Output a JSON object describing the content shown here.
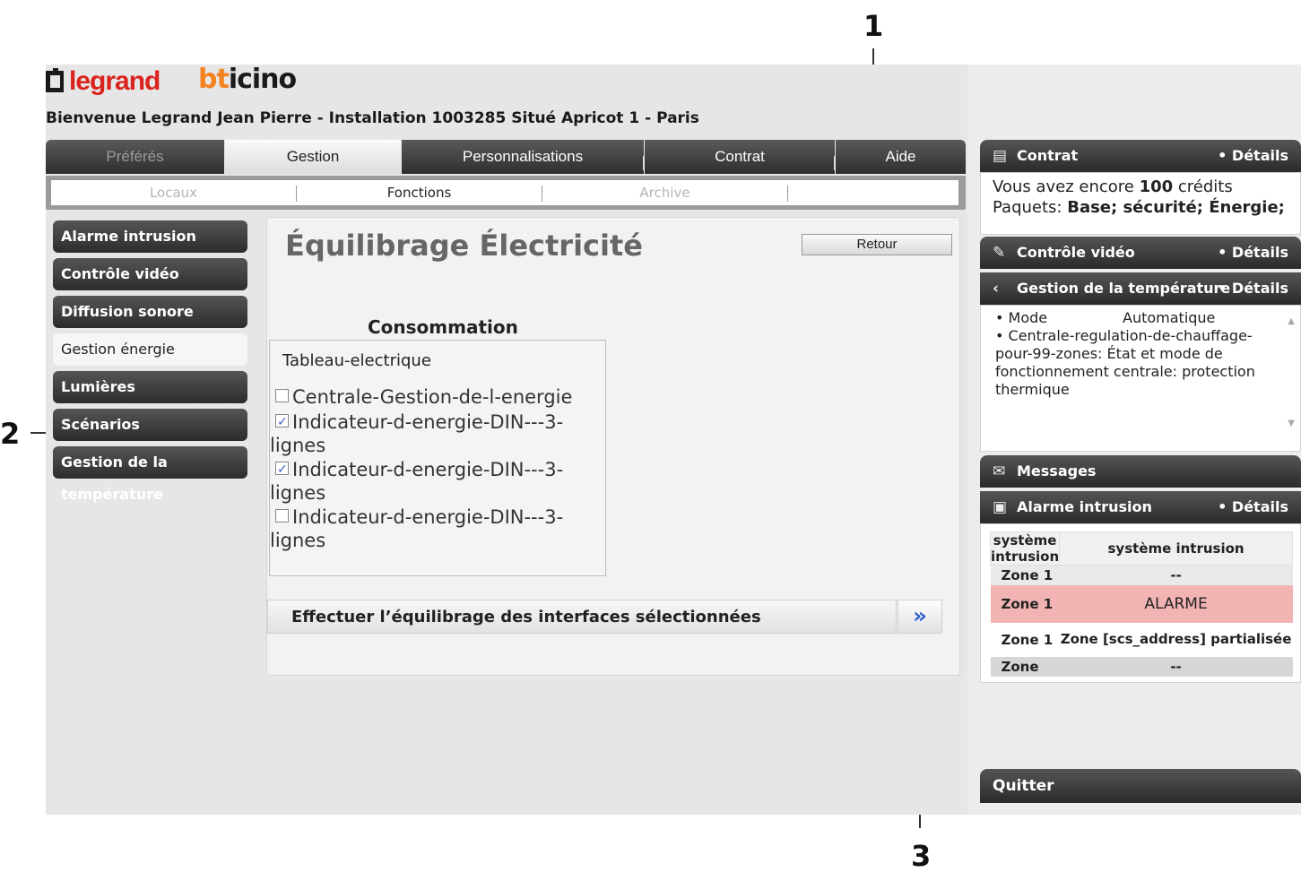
{
  "callouts": [
    "1",
    "2",
    "3"
  ],
  "brand": {
    "legrand": "legrand",
    "bticino_b": "bt",
    "bticino_rest": "icino"
  },
  "welcome": "Bienvenue Legrand Jean Pierre - Installation 1003285 Situé Apricot 1 - Paris",
  "topnav": [
    "Préférés",
    "Gestion",
    "Personnalisations",
    "Contrat",
    "Aide"
  ],
  "subnav": [
    "Locaux",
    "Fonctions",
    "Archive"
  ],
  "menu": [
    "Alarme intrusion",
    "Contrôle vidéo",
    "Diffusion sonore",
    "Gestion énergie",
    "Lumières",
    "Scénarios",
    "Gestion de la température"
  ],
  "content": {
    "title": "Équilibrage Électricité",
    "retour": "Retour",
    "conso_title": "Consommation",
    "tableau": "Tableau-electrique",
    "items": [
      {
        "line1": "Centrale-Gestion-de-l-energie",
        "line2": "",
        "checked": false
      },
      {
        "line1": "Indicateur-d-energie-DIN---3-",
        "line2": "lignes",
        "checked": true
      },
      {
        "line1": "Indicateur-d-energie-DIN---3-",
        "line2": "lignes",
        "checked": true
      },
      {
        "line1": "Indicateur-d-energie-DIN---3-",
        "line2": "lignes",
        "checked": false
      }
    ],
    "action_label": "Effectuer l’équilibrage des interfaces sélectionnées",
    "action_btn": "»"
  },
  "right": {
    "contrat": {
      "title": "Contrat",
      "details": "• Détails",
      "line1_pre": "Vous avez encore ",
      "line1_num": "100",
      "line1_post": " crédits",
      "line2_pre": "Paquets: ",
      "line2_val": "Base; sécurité; Énergie;"
    },
    "video": {
      "title": "Contrôle vidéo",
      "details": "• Détails"
    },
    "temp": {
      "title": "Gestion de la température",
      "details": "• Détails",
      "mode_label": "• Mode",
      "mode_value": "Automatique",
      "line2": "• Centrale-regulation-de-chauffage-pour-99-zones: État et mode de fonctionnement centrale: protection thermique"
    },
    "messages": {
      "title": "Messages"
    },
    "alarme": {
      "title": "Alarme intrusion",
      "details": "• Détails",
      "headers": [
        "système intrusion",
        "système intrusion"
      ],
      "rows": [
        {
          "zone": "Zone 1",
          "value": "--"
        },
        {
          "zone": "Zone 1",
          "value": "ALARME"
        },
        {
          "zone": "Zone 1",
          "value": "Zone [scs_address] partialisée"
        },
        {
          "zone": "Zone",
          "value": "--"
        }
      ]
    },
    "quit": "Quitter"
  },
  "colors": {
    "legrand_red": "#d9231c",
    "bticino_orange": "#f58220",
    "alarm_row": "#f2b3b3",
    "action_arrow": "#2a5ccf"
  }
}
